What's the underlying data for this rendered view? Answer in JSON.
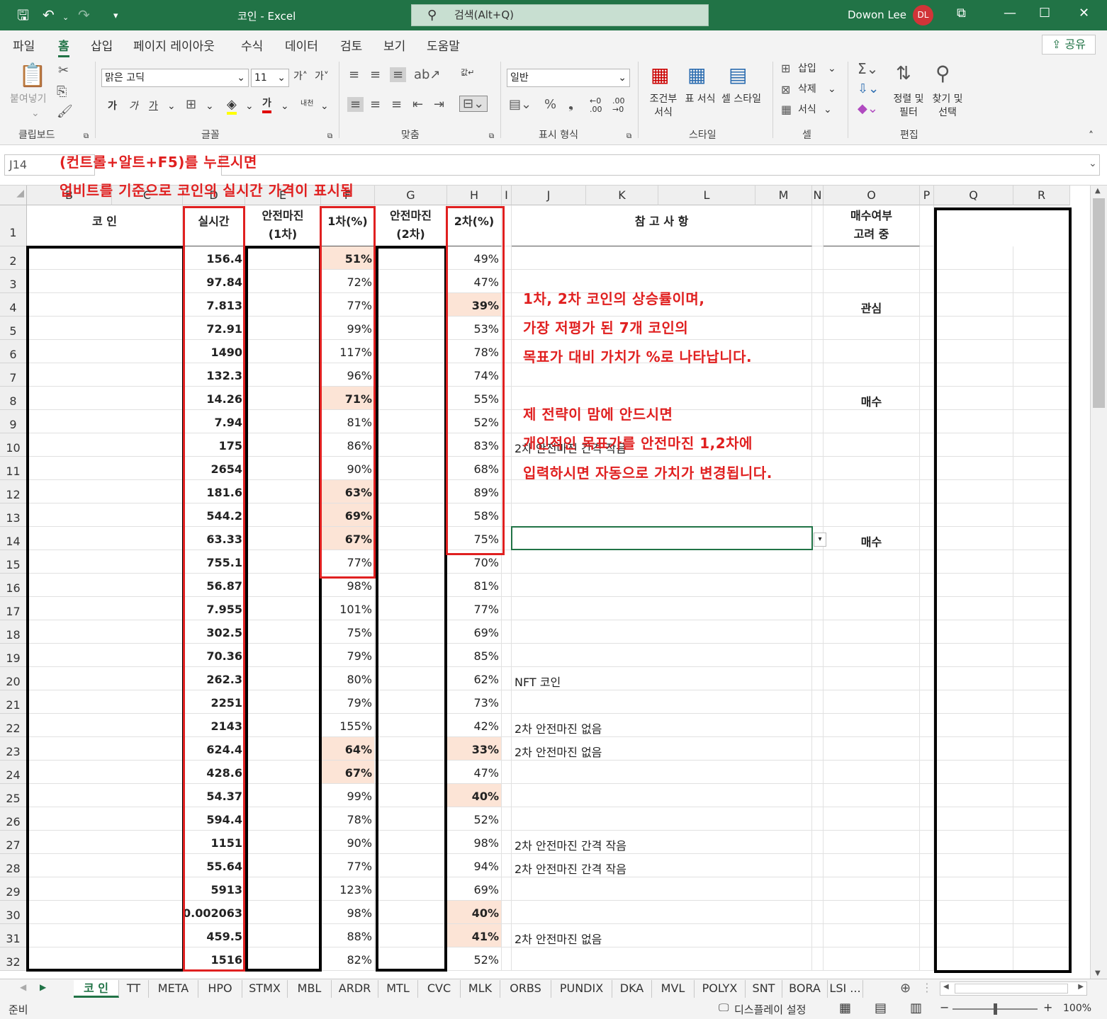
{
  "window": {
    "title": "코인 - Excel",
    "search_placeholder": "검색(Alt+Q)",
    "user": "Dowon Lee",
    "avatar": "DL"
  },
  "menu": [
    "파일",
    "홈",
    "삽입",
    "페이지 레이아웃",
    "수식",
    "데이터",
    "검토",
    "보기",
    "도움말"
  ],
  "share_label": "공유",
  "ribbon": {
    "paste": "붙여넣기",
    "group_clipboard": "클립보드",
    "font_name": "맑은 고딕",
    "font_size": "11",
    "group_font": "글꼴",
    "bold": "가",
    "italic": "가",
    "underline": "가",
    "font_color_glyph": "가",
    "phonetic": "내천",
    "group_align": "맞춤",
    "wrap": "값↵",
    "number_format": "일반",
    "group_number": "표시 형식",
    "cond_format": "조건부 서식",
    "table_format": "표 서식",
    "cell_style": "셀 스타일",
    "group_style": "스타일",
    "insert": "삽입",
    "delete": "삭제",
    "format": "서식",
    "group_cells": "셀",
    "sort_filter": "정렬 및 필터",
    "find_select": "찾기 및 선택",
    "group_edit": "편집"
  },
  "name_box": "J14",
  "annotations": {
    "top1": "(컨트롤+알트+F5)를 누르시면",
    "top2": "업비트를 기준으로 코인의 실시간 가격이 표시됨",
    "note1": "1차, 2차 코인의 상승률이며,",
    "note2": "가장 저평가 된 7개 코인의",
    "note3": "목표가 대비 가치가 %로 나타납니다.",
    "note4": "제 전략이 맘에 안드시면",
    "note5": "개인적인 목표가를 안전마진 1,2차에",
    "note6": "입력하시면 자동으로 가치가 변경됩니다."
  },
  "columns": [
    "B",
    "C",
    "D",
    "E",
    "F",
    "G",
    "H",
    "I",
    "J",
    "K",
    "L",
    "M",
    "N",
    "O",
    "P",
    "Q",
    "R"
  ],
  "headers": {
    "coin": "코 인",
    "realtime": "실시간",
    "margin1a": "안전마진",
    "margin1b": "(1차)",
    "pct1": "1차(%)",
    "margin2a": "안전마진",
    "margin2b": "(2차)",
    "pct2": "2차(%)",
    "note": "참 고 사 항",
    "buy_a": "매수여부",
    "buy_b": "고려 중"
  },
  "rows": [
    {
      "n": "2",
      "price": "156.4",
      "p1": "51%",
      "p2": "49%",
      "note": "",
      "buy": ""
    },
    {
      "n": "3",
      "price": "97.84",
      "p1": "72%",
      "p2": "47%",
      "note": "",
      "buy": ""
    },
    {
      "n": "4",
      "price": "7.813",
      "p1": "77%",
      "p2": "39%",
      "note": "",
      "buy": "관심"
    },
    {
      "n": "5",
      "price": "72.91",
      "p1": "99%",
      "p2": "53%",
      "note": "",
      "buy": ""
    },
    {
      "n": "6",
      "price": "1490",
      "p1": "117%",
      "p2": "78%",
      "note": "",
      "buy": ""
    },
    {
      "n": "7",
      "price": "132.3",
      "p1": "96%",
      "p2": "74%",
      "note": "",
      "buy": ""
    },
    {
      "n": "8",
      "price": "14.26",
      "p1": "71%",
      "p2": "55%",
      "note": "",
      "buy": "매수"
    },
    {
      "n": "9",
      "price": "7.94",
      "p1": "81%",
      "p2": "52%",
      "note": "",
      "buy": ""
    },
    {
      "n": "10",
      "price": "175",
      "p1": "86%",
      "p2": "83%",
      "note": "2차 안전마진 간격 작음",
      "buy": ""
    },
    {
      "n": "11",
      "price": "2654",
      "p1": "90%",
      "p2": "68%",
      "note": "",
      "buy": ""
    },
    {
      "n": "12",
      "price": "181.6",
      "p1": "63%",
      "p2": "89%",
      "note": "",
      "buy": ""
    },
    {
      "n": "13",
      "price": "544.2",
      "p1": "69%",
      "p2": "58%",
      "note": "",
      "buy": ""
    },
    {
      "n": "14",
      "price": "63.33",
      "p1": "67%",
      "p2": "75%",
      "note": "",
      "buy": "매수"
    },
    {
      "n": "15",
      "price": "755.1",
      "p1": "77%",
      "p2": "70%",
      "note": "",
      "buy": ""
    },
    {
      "n": "16",
      "price": "56.87",
      "p1": "98%",
      "p2": "81%",
      "note": "",
      "buy": ""
    },
    {
      "n": "17",
      "price": "7.955",
      "p1": "101%",
      "p2": "77%",
      "note": "",
      "buy": ""
    },
    {
      "n": "18",
      "price": "302.5",
      "p1": "75%",
      "p2": "69%",
      "note": "",
      "buy": ""
    },
    {
      "n": "19",
      "price": "70.36",
      "p1": "79%",
      "p2": "85%",
      "note": "",
      "buy": ""
    },
    {
      "n": "20",
      "price": "262.3",
      "p1": "80%",
      "p2": "62%",
      "note": "NFT 코인",
      "buy": ""
    },
    {
      "n": "21",
      "price": "2251",
      "p1": "79%",
      "p2": "73%",
      "note": "",
      "buy": ""
    },
    {
      "n": "22",
      "price": "2143",
      "p1": "155%",
      "p2": "42%",
      "note": "2차 안전마진 없음",
      "buy": ""
    },
    {
      "n": "23",
      "price": "624.4",
      "p1": "64%",
      "p2": "33%",
      "note": "2차 안전마진 없음",
      "buy": ""
    },
    {
      "n": "24",
      "price": "428.6",
      "p1": "67%",
      "p2": "47%",
      "note": "",
      "buy": ""
    },
    {
      "n": "25",
      "price": "54.37",
      "p1": "99%",
      "p2": "40%",
      "note": "",
      "buy": ""
    },
    {
      "n": "26",
      "price": "594.4",
      "p1": "78%",
      "p2": "52%",
      "note": "",
      "buy": ""
    },
    {
      "n": "27",
      "price": "1151",
      "p1": "90%",
      "p2": "98%",
      "note": "2차 안전마진 간격 작음",
      "buy": ""
    },
    {
      "n": "28",
      "price": "55.64",
      "p1": "77%",
      "p2": "94%",
      "note": "2차 안전마진 간격 작음",
      "buy": ""
    },
    {
      "n": "29",
      "price": "5913",
      "p1": "123%",
      "p2": "69%",
      "note": "",
      "buy": ""
    },
    {
      "n": "30",
      "price": "0.002063",
      "p1": "98%",
      "p2": "40%",
      "note": "",
      "buy": ""
    },
    {
      "n": "31",
      "price": "459.5",
      "p1": "88%",
      "p2": "41%",
      "note": "2차 안전마진 없음",
      "buy": ""
    },
    {
      "n": "32",
      "price": "1516",
      "p1": "82%",
      "p2": "52%",
      "note": "",
      "buy": ""
    }
  ],
  "highlights": {
    "p1": [
      "51%",
      "71%",
      "63%",
      "69%",
      "67%",
      "64%",
      "67%"
    ],
    "p1_rows": [
      2,
      8,
      12,
      13,
      14,
      23,
      24
    ],
    "p2_rows": [
      4,
      23,
      25,
      30,
      31
    ]
  },
  "sheets": [
    "코 인",
    "TT",
    "META",
    "HPO",
    "STMX",
    "MBL",
    "ARDR",
    "MTL",
    "CVC",
    "MLK",
    "ORBS",
    "PUNDIX",
    "DKA",
    "MVL",
    "POLYX",
    "SNT",
    "BORA",
    "LSI ..."
  ],
  "status": {
    "ready": "준비",
    "display": "디스플레이 설정",
    "zoom": "100%"
  },
  "colors": {
    "excel_green": "#217346",
    "highlight": "#fce4d6",
    "annotation_red": "#e02020"
  }
}
